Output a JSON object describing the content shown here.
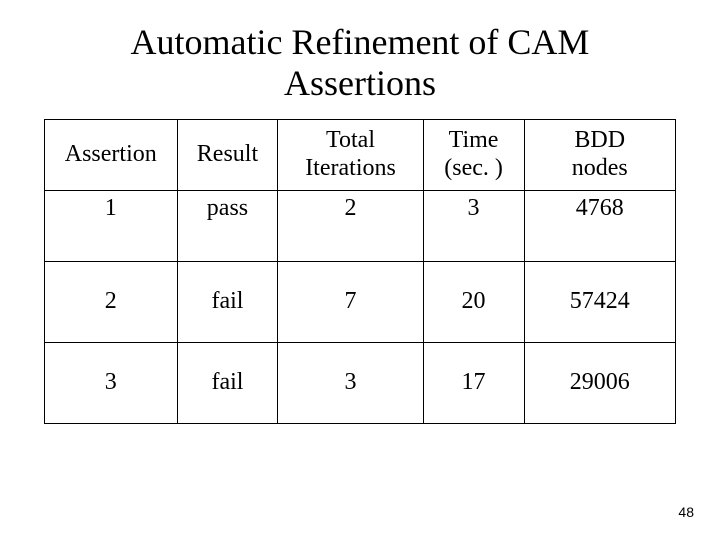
{
  "title_line1": "Automatic Refinement of CAM",
  "title_line2": "Assertions",
  "headers": {
    "c1": "Assertion",
    "c2": "Result",
    "c3_l1": "Total",
    "c3_l2": "Iterations",
    "c4_l1": "Time",
    "c4_l2": "(sec. )",
    "c5_l1": "BDD",
    "c5_l2": "nodes"
  },
  "rows": [
    {
      "assertion": "1",
      "result": "pass",
      "iterations": "2",
      "time": "3",
      "bdd": "4768"
    },
    {
      "assertion": "2",
      "result": "fail",
      "iterations": "7",
      "time": "20",
      "bdd": "57424"
    },
    {
      "assertion": "3",
      "result": "fail",
      "iterations": "3",
      "time": "17",
      "bdd": "29006"
    }
  ],
  "page_number": "48",
  "chart_data": {
    "type": "table",
    "title": "Automatic Refinement of CAM Assertions",
    "columns": [
      "Assertion",
      "Result",
      "Total Iterations",
      "Time (sec.)",
      "BDD nodes"
    ],
    "rows": [
      [
        1,
        "pass",
        2,
        3,
        4768
      ],
      [
        2,
        "fail",
        7,
        20,
        57424
      ],
      [
        3,
        "fail",
        3,
        17,
        29006
      ]
    ]
  }
}
